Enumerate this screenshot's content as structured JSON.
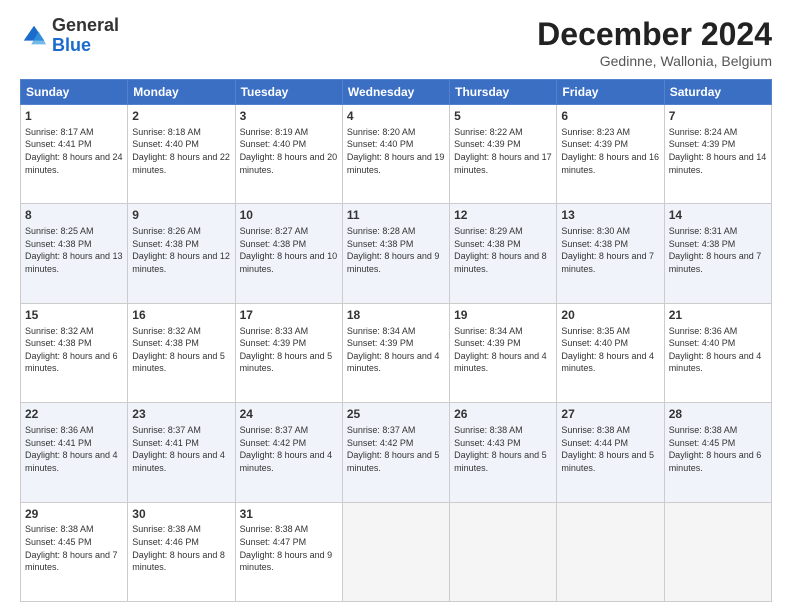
{
  "logo": {
    "general": "General",
    "blue": "Blue"
  },
  "title": "December 2024",
  "subtitle": "Gedinne, Wallonia, Belgium",
  "days_header": [
    "Sunday",
    "Monday",
    "Tuesday",
    "Wednesday",
    "Thursday",
    "Friday",
    "Saturday"
  ],
  "weeks": [
    [
      {
        "day": "1",
        "sunrise": "Sunrise: 8:17 AM",
        "sunset": "Sunset: 4:41 PM",
        "daylight": "Daylight: 8 hours and 24 minutes."
      },
      {
        "day": "2",
        "sunrise": "Sunrise: 8:18 AM",
        "sunset": "Sunset: 4:40 PM",
        "daylight": "Daylight: 8 hours and 22 minutes."
      },
      {
        "day": "3",
        "sunrise": "Sunrise: 8:19 AM",
        "sunset": "Sunset: 4:40 PM",
        "daylight": "Daylight: 8 hours and 20 minutes."
      },
      {
        "day": "4",
        "sunrise": "Sunrise: 8:20 AM",
        "sunset": "Sunset: 4:40 PM",
        "daylight": "Daylight: 8 hours and 19 minutes."
      },
      {
        "day": "5",
        "sunrise": "Sunrise: 8:22 AM",
        "sunset": "Sunset: 4:39 PM",
        "daylight": "Daylight: 8 hours and 17 minutes."
      },
      {
        "day": "6",
        "sunrise": "Sunrise: 8:23 AM",
        "sunset": "Sunset: 4:39 PM",
        "daylight": "Daylight: 8 hours and 16 minutes."
      },
      {
        "day": "7",
        "sunrise": "Sunrise: 8:24 AM",
        "sunset": "Sunset: 4:39 PM",
        "daylight": "Daylight: 8 hours and 14 minutes."
      }
    ],
    [
      {
        "day": "8",
        "sunrise": "Sunrise: 8:25 AM",
        "sunset": "Sunset: 4:38 PM",
        "daylight": "Daylight: 8 hours and 13 minutes."
      },
      {
        "day": "9",
        "sunrise": "Sunrise: 8:26 AM",
        "sunset": "Sunset: 4:38 PM",
        "daylight": "Daylight: 8 hours and 12 minutes."
      },
      {
        "day": "10",
        "sunrise": "Sunrise: 8:27 AM",
        "sunset": "Sunset: 4:38 PM",
        "daylight": "Daylight: 8 hours and 10 minutes."
      },
      {
        "day": "11",
        "sunrise": "Sunrise: 8:28 AM",
        "sunset": "Sunset: 4:38 PM",
        "daylight": "Daylight: 8 hours and 9 minutes."
      },
      {
        "day": "12",
        "sunrise": "Sunrise: 8:29 AM",
        "sunset": "Sunset: 4:38 PM",
        "daylight": "Daylight: 8 hours and 8 minutes."
      },
      {
        "day": "13",
        "sunrise": "Sunrise: 8:30 AM",
        "sunset": "Sunset: 4:38 PM",
        "daylight": "Daylight: 8 hours and 7 minutes."
      },
      {
        "day": "14",
        "sunrise": "Sunrise: 8:31 AM",
        "sunset": "Sunset: 4:38 PM",
        "daylight": "Daylight: 8 hours and 7 minutes."
      }
    ],
    [
      {
        "day": "15",
        "sunrise": "Sunrise: 8:32 AM",
        "sunset": "Sunset: 4:38 PM",
        "daylight": "Daylight: 8 hours and 6 minutes."
      },
      {
        "day": "16",
        "sunrise": "Sunrise: 8:32 AM",
        "sunset": "Sunset: 4:38 PM",
        "daylight": "Daylight: 8 hours and 5 minutes."
      },
      {
        "day": "17",
        "sunrise": "Sunrise: 8:33 AM",
        "sunset": "Sunset: 4:39 PM",
        "daylight": "Daylight: 8 hours and 5 minutes."
      },
      {
        "day": "18",
        "sunrise": "Sunrise: 8:34 AM",
        "sunset": "Sunset: 4:39 PM",
        "daylight": "Daylight: 8 hours and 4 minutes."
      },
      {
        "day": "19",
        "sunrise": "Sunrise: 8:34 AM",
        "sunset": "Sunset: 4:39 PM",
        "daylight": "Daylight: 8 hours and 4 minutes."
      },
      {
        "day": "20",
        "sunrise": "Sunrise: 8:35 AM",
        "sunset": "Sunset: 4:40 PM",
        "daylight": "Daylight: 8 hours and 4 minutes."
      },
      {
        "day": "21",
        "sunrise": "Sunrise: 8:36 AM",
        "sunset": "Sunset: 4:40 PM",
        "daylight": "Daylight: 8 hours and 4 minutes."
      }
    ],
    [
      {
        "day": "22",
        "sunrise": "Sunrise: 8:36 AM",
        "sunset": "Sunset: 4:41 PM",
        "daylight": "Daylight: 8 hours and 4 minutes."
      },
      {
        "day": "23",
        "sunrise": "Sunrise: 8:37 AM",
        "sunset": "Sunset: 4:41 PM",
        "daylight": "Daylight: 8 hours and 4 minutes."
      },
      {
        "day": "24",
        "sunrise": "Sunrise: 8:37 AM",
        "sunset": "Sunset: 4:42 PM",
        "daylight": "Daylight: 8 hours and 4 minutes."
      },
      {
        "day": "25",
        "sunrise": "Sunrise: 8:37 AM",
        "sunset": "Sunset: 4:42 PM",
        "daylight": "Daylight: 8 hours and 5 minutes."
      },
      {
        "day": "26",
        "sunrise": "Sunrise: 8:38 AM",
        "sunset": "Sunset: 4:43 PM",
        "daylight": "Daylight: 8 hours and 5 minutes."
      },
      {
        "day": "27",
        "sunrise": "Sunrise: 8:38 AM",
        "sunset": "Sunset: 4:44 PM",
        "daylight": "Daylight: 8 hours and 5 minutes."
      },
      {
        "day": "28",
        "sunrise": "Sunrise: 8:38 AM",
        "sunset": "Sunset: 4:45 PM",
        "daylight": "Daylight: 8 hours and 6 minutes."
      }
    ],
    [
      {
        "day": "29",
        "sunrise": "Sunrise: 8:38 AM",
        "sunset": "Sunset: 4:45 PM",
        "daylight": "Daylight: 8 hours and 7 minutes."
      },
      {
        "day": "30",
        "sunrise": "Sunrise: 8:38 AM",
        "sunset": "Sunset: 4:46 PM",
        "daylight": "Daylight: 8 hours and 8 minutes."
      },
      {
        "day": "31",
        "sunrise": "Sunrise: 8:38 AM",
        "sunset": "Sunset: 4:47 PM",
        "daylight": "Daylight: 8 hours and 9 minutes."
      },
      null,
      null,
      null,
      null
    ]
  ]
}
